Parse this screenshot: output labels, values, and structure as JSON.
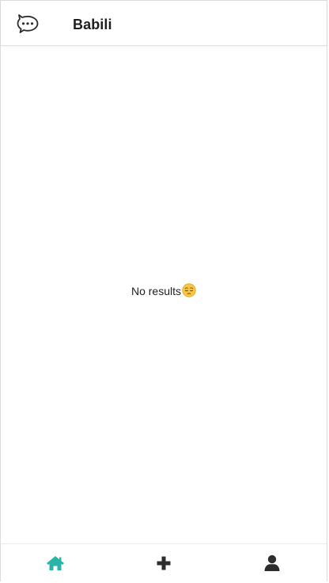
{
  "header": {
    "title": "Babili",
    "logo_icon": "chat-bubble-icon"
  },
  "main": {
    "empty_text": "No results",
    "empty_emoji": "pensive-face-emoji"
  },
  "tabbar": {
    "items": [
      {
        "icon": "home-icon",
        "active": true
      },
      {
        "icon": "plus-icon",
        "active": false
      },
      {
        "icon": "user-icon",
        "active": false
      }
    ]
  },
  "colors": {
    "accent": "#2bb3a8",
    "icon": "#2d2d2d",
    "text": "#1e1e1e"
  }
}
